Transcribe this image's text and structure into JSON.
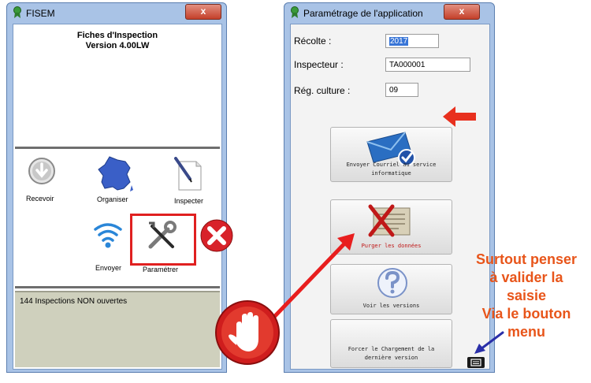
{
  "left_window": {
    "title": "FISEM",
    "close_label": "x",
    "header_title": "Fiches d'Inspection",
    "header_version": "Version 4.00LW",
    "actions": {
      "recevoir": "Recevoir",
      "organiser": "Organiser",
      "inspecter": "Inspecter",
      "envoyer": "Envoyer",
      "parametrer": "Paramétrer"
    },
    "status_text": "144 Inspections NON ouvertes"
  },
  "right_window": {
    "title": "Paramétrage de l'application",
    "close_label": "x",
    "fields": {
      "recolte_label": "Récolte :",
      "recolte_value": "2017",
      "inspecteur_label": "Inspecteur :",
      "inspecteur_value": "TA000001",
      "reg_culture_label": "Rég. culture :",
      "reg_culture_value": "09"
    },
    "buttons": {
      "envoyer_courriel": "Envoyer Courriel au service informatique",
      "purger": "Purger les données",
      "voir_versions": "Voir les versions",
      "forcer": "Forcer le Chargement de la dernière version"
    }
  },
  "annotation": {
    "line1": "Surtout penser",
    "line2": "à valider la",
    "line3": "saisie",
    "line4": "Via le bouton",
    "line5": "menu"
  },
  "colors": {
    "titlebar": "#a9c3e6",
    "close_button": "#c4402a",
    "annotation": "#e8551a",
    "highlight_box": "#e02020",
    "status_bar": "#cfd0bd"
  }
}
